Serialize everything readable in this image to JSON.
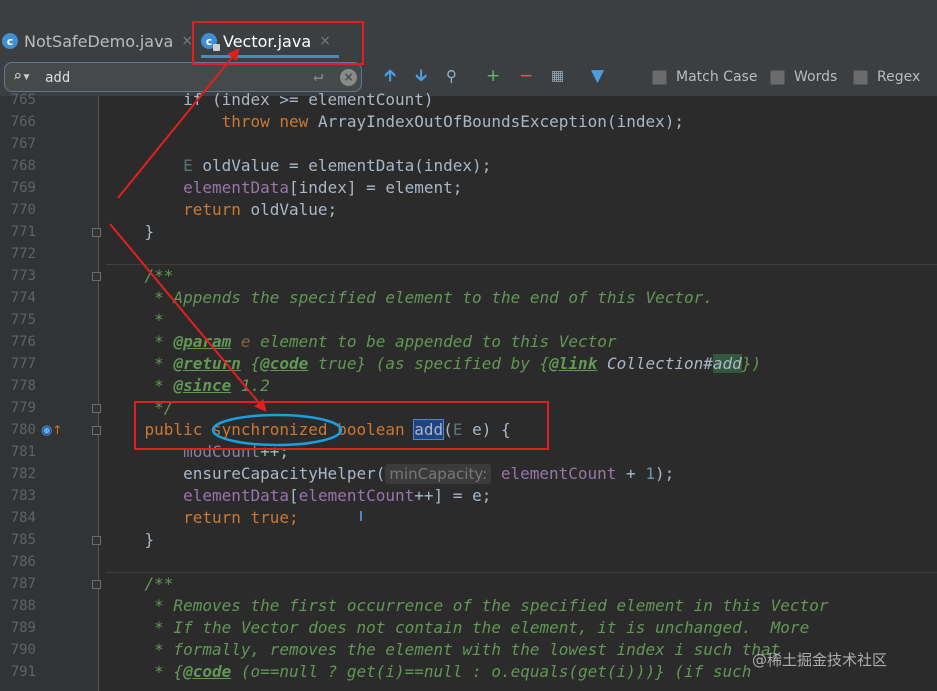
{
  "tabs": [
    {
      "label": "NotSafeDemo.java",
      "close": "×",
      "active": false
    },
    {
      "label": "Vector.java",
      "close": "×",
      "active": true
    }
  ],
  "find": {
    "query": "add",
    "options": {
      "match_case": "Match Case",
      "words": "Words",
      "regex": "Regex"
    }
  },
  "icons": {
    "search": "search-icon",
    "up": "arrow-up-icon",
    "down": "arrow-down-icon",
    "find_all": "find-all-icon",
    "add_occurrence": "add-occurrence-icon",
    "remove_occurrence": "remove-occurrence-icon",
    "select_all": "select-all-occurrences-icon",
    "filter": "filter-icon"
  },
  "colors": {
    "keyword": "#cc7832",
    "comment": "#629755",
    "field": "#9876aa",
    "annotation": "#e02020",
    "highlight_ellipse": "#1a9fe0"
  },
  "editor": {
    "line_numbers": [
      "765",
      "766",
      "767",
      "768",
      "769",
      "770",
      "771",
      "772",
      "773",
      "774",
      "775",
      "776",
      "777",
      "778",
      "779",
      "780",
      "781",
      "782",
      "783",
      "784",
      "785",
      "786",
      "787",
      "788",
      "789",
      "790",
      "791"
    ],
    "line766": {
      "kw1": "throw",
      "kw2": "new",
      "rest": " ArrayIndexOutOfBoundsException(index);"
    },
    "line765": "if (index >= elementCount)",
    "line768": {
      "type": "E",
      "rest": " oldValue = elementData(index);"
    },
    "line769": {
      "field": "elementData",
      "rest": "[index] = element;"
    },
    "line770": {
      "kw": "return",
      "rest": " oldValue;"
    },
    "line771": "}",
    "line773": "/**",
    "line774": " * Appends the specified element to the end of this Vector.",
    "line775": " *",
    "line776": {
      "prefix": " * ",
      "tag": "@param",
      "param": " e",
      "text": " element to be appended to this Vector"
    },
    "line777": {
      "prefix": " * ",
      "tag": "@return",
      "open": " {",
      "code": "@code",
      "rest": " true} (as specified by {",
      "link": "@link",
      "ref": " Collection#",
      "target": "add",
      "close": "})"
    },
    "line778": {
      "prefix": " * ",
      "tag": "@since",
      "rest": " 1.2"
    },
    "line779": " */",
    "line780": {
      "pub": "public",
      "sync": "synchronized",
      "bool": "boolean",
      "method": "add",
      "paren": "(",
      "type": "E",
      "rest": " e) {"
    },
    "line781": {
      "field": "modCount",
      "rest": "++;"
    },
    "line782": {
      "call": "ensureCapacityHelper(",
      "hint": "minCapacity:",
      "field": "elementCount",
      "rest": " + ",
      "num": "1",
      "end": ");"
    },
    "line783": {
      "field1": "elementData",
      "mid": "[",
      "field2": "elementCount",
      "end": "++] = e;"
    },
    "line784": {
      "kw": "return",
      "val": "true",
      "end": ";"
    },
    "line785": "}",
    "line787": "/**",
    "line788": " * Removes the first occurrence of the specified element in this Vector",
    "line789": " * If the Vector does not contain the element, it is unchanged.  More",
    "line790": " * formally, removes the element with the lowest index i such that",
    "line791": {
      "prefix": " * {",
      "code": "@code",
      "rest": " (o==null ? get(i)==null : o.equals(get(i)))} (if such"
    }
  },
  "watermark": "@稀土掘金技术社区"
}
